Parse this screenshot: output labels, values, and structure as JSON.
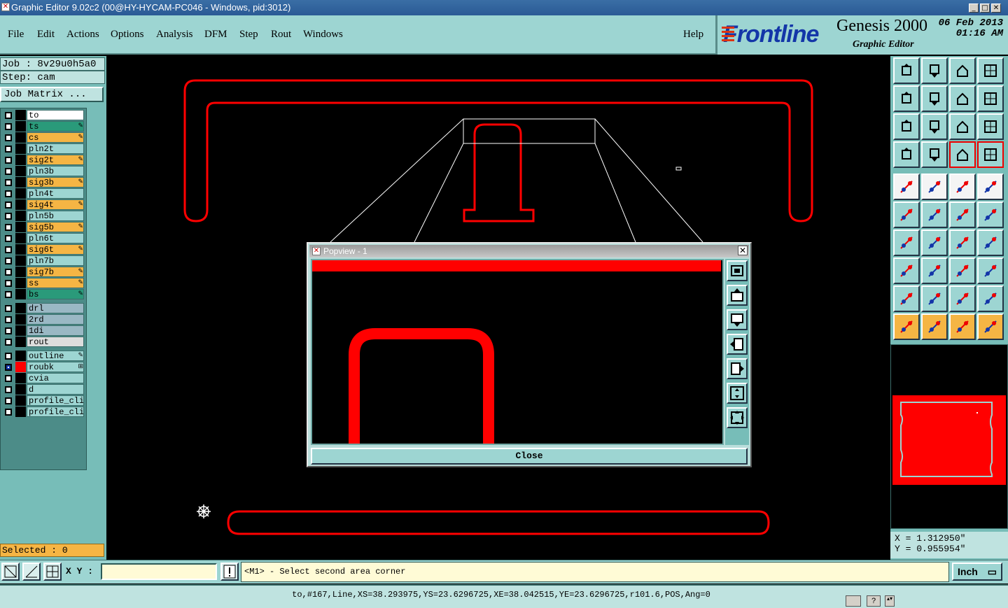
{
  "window": {
    "title": "Graphic Editor 9.02c2 (00@HY-HYCAM-PC046 - Windows, pid:3012)",
    "controls": [
      "_",
      "□",
      "✕"
    ]
  },
  "menu": {
    "items": [
      "File",
      "Edit",
      "Actions",
      "Options",
      "Analysis",
      "DFM",
      "Step",
      "Rout",
      "Windows"
    ],
    "help": "Help"
  },
  "brand": {
    "logo": "Frontline",
    "product": "Genesis 2000",
    "subtitle": "Graphic Editor",
    "date": "06 Feb 2013",
    "time": "01:16 AM"
  },
  "job": {
    "job_label": "Job : 8v29u0h5a0",
    "step_label": "Step: cam",
    "job_matrix": "Job Matrix ..."
  },
  "layers": [
    {
      "name": "to",
      "color": "#ffffff",
      "mark": ""
    },
    {
      "name": "ts",
      "color": "#2a9a7a",
      "mark": "✎"
    },
    {
      "name": "cs",
      "color": "#f5b544",
      "mark": "✎"
    },
    {
      "name": "pln2t",
      "color": "#9dd5d2",
      "mark": ""
    },
    {
      "name": "sig2t",
      "color": "#f5b544",
      "mark": "✎"
    },
    {
      "name": "pln3b",
      "color": "#9dd5d2",
      "mark": ""
    },
    {
      "name": "sig3b",
      "color": "#f5b544",
      "mark": "✎"
    },
    {
      "name": "pln4t",
      "color": "#9dd5d2",
      "mark": ""
    },
    {
      "name": "sig4t",
      "color": "#f5b544",
      "mark": "✎"
    },
    {
      "name": "pln5b",
      "color": "#9dd5d2",
      "mark": ""
    },
    {
      "name": "sig5b",
      "color": "#f5b544",
      "mark": "✎"
    },
    {
      "name": "pln6t",
      "color": "#9dd5d2",
      "mark": ""
    },
    {
      "name": "sig6t",
      "color": "#f5b544",
      "mark": "✎"
    },
    {
      "name": "pln7b",
      "color": "#9dd5d2",
      "mark": ""
    },
    {
      "name": "sig7b",
      "color": "#f5b544",
      "mark": "✎"
    },
    {
      "name": "ss",
      "color": "#f5b544",
      "mark": "✎"
    },
    {
      "name": "bs",
      "color": "#2a9a7a",
      "mark": "✎"
    },
    {
      "name": "drl",
      "color": "#9ab8c4",
      "mark": ""
    },
    {
      "name": "2rd",
      "color": "#9ab8c4",
      "mark": ""
    },
    {
      "name": "1di",
      "color": "#9ab8c4",
      "mark": ""
    },
    {
      "name": "rout",
      "color": "#dddddd",
      "mark": ""
    },
    {
      "name": "outline",
      "color": "#9dd5d2",
      "mark": "✎"
    },
    {
      "name": "roubk",
      "color": "#9dd5d2",
      "mark": "⊞"
    },
    {
      "name": "cvia",
      "color": "#9dd5d2",
      "mark": ""
    },
    {
      "name": "d",
      "color": "#9dd5d2",
      "mark": ""
    },
    {
      "name": "profile_cli",
      "color": "#9dd5d2",
      "mark": ""
    },
    {
      "name": "profile_cli",
      "color": "#9dd5d2",
      "mark": ""
    }
  ],
  "selected": "Selected : 0",
  "toolbar_icons": [
    "zoom-home-icon",
    "zoom-in-icon",
    "home-icon",
    "grid-icon",
    "pan-left-icon",
    "pan-right-icon",
    "snap-icon",
    "redraw-icon",
    "fit-icon",
    "center-icon",
    "scale-icon",
    "help-icon",
    "measure-icon",
    "connect-icon",
    "net-icon",
    "net-select-icon",
    "pad-icon",
    "polygon-icon",
    "ruler-icon",
    "circle-icon",
    "points-icon",
    "cross-icon",
    "line-icon",
    "line-alt-icon",
    "angle-icon",
    "diag-icon",
    "arc-icon",
    "split-icon",
    "copy-icon",
    "resize-icon",
    "fillet-icon",
    "shapes-icon",
    "triangle-icon",
    "triangle-alt-icon",
    "triangle-arch-icon",
    "arch-icon",
    "pointer-icon",
    "pointer-box-icon",
    "pointer-circle-icon",
    "route-icon"
  ],
  "coords": {
    "x": "X = 1.312950\"",
    "y": "Y = 0.955954\""
  },
  "bottom": {
    "xy_label": "X Y :",
    "xy_value": "",
    "prompt": "<M1> - Select second area corner",
    "units": "Inch"
  },
  "status": "to,#167,Line,XS=38.293975,YS=23.6296725,XE=38.042515,YE=23.6296725,r101.6,POS,Ang=0",
  "popview": {
    "title": "Popview - 1",
    "close": "Close"
  },
  "colors": {
    "accent": "#ff0000",
    "panel": "#77bdb8",
    "menu": "#9dd5d2",
    "selection": "#f5b544"
  }
}
